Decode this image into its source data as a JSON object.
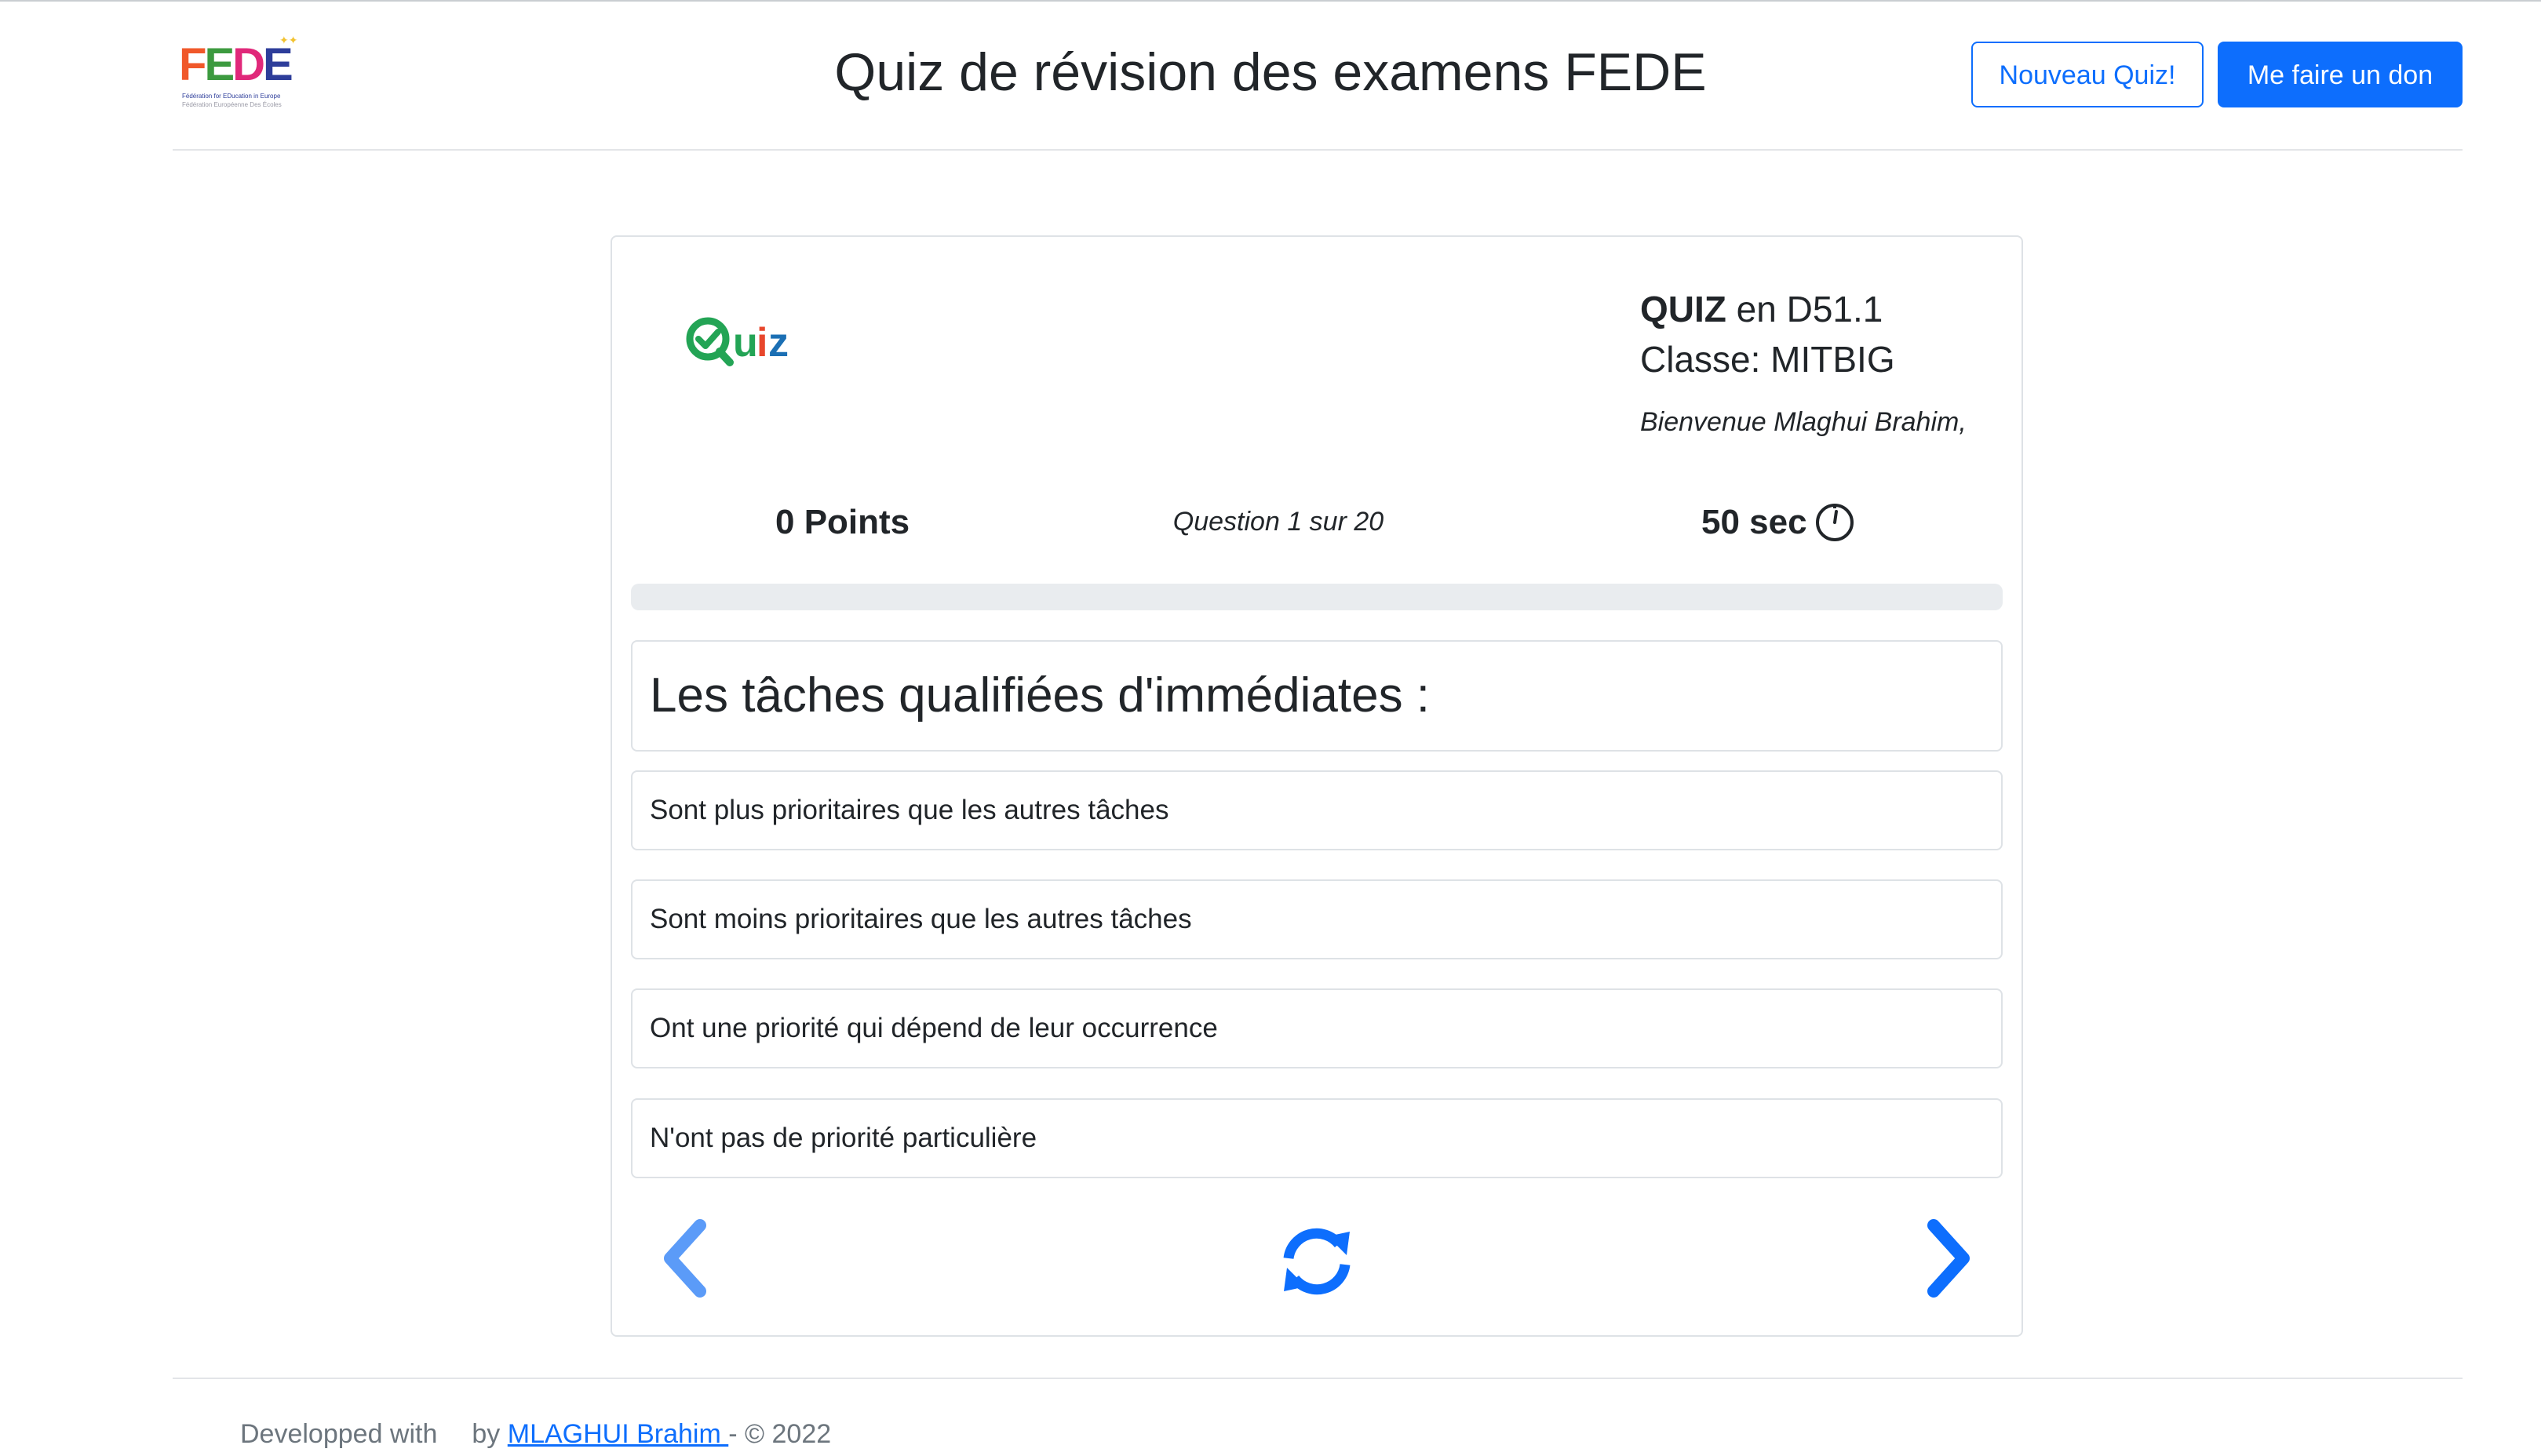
{
  "header": {
    "logo": {
      "text": "FEDE",
      "letter_colors": [
        "#f0582a",
        "#3c9a3f",
        "#e0287a",
        "#2d3d9a"
      ],
      "subtitle_line1": "Fédération for EDucation in Europe",
      "subtitle_line2": "Fédération Européenne Des Écoles"
    },
    "title": "Quiz de révision des examens FEDE",
    "new_quiz_label": "Nouveau Quiz!",
    "donate_label": "Me faire un don"
  },
  "quiz": {
    "logo_text": "Quiz",
    "label_bold": "QUIZ",
    "label_rest": " en D51.1",
    "class_line": "Classe: MITBIG",
    "welcome": "Bienvenue Mlaghui Brahim,",
    "points": "0 Points",
    "question_counter": "Question 1 sur 20",
    "timer": "50 sec",
    "progress_percent": 0,
    "question": "Les tâches qualifiées d'immédiates :",
    "answers": [
      "Sont plus prioritaires que les autres tâches",
      "Sont moins prioritaires que les autres tâches",
      "Ont une priorité qui dépend de leur occurrence",
      "N'ont pas de priorité particulière"
    ]
  },
  "footer": {
    "prefix": "Developped with",
    "by": "by ",
    "author": "MLAGHUI Brahim ",
    "suffix": " - © 2022"
  },
  "colors": {
    "primary": "#0d6efd",
    "prev_arrow": "#5b9bf8",
    "quiz_green": "#23a455",
    "quiz_blue": "#1b6fb4"
  },
  "icons": [
    "logo-image",
    "quiz-logo-image",
    "stopwatch-icon",
    "chevron-left-icon",
    "refresh-icon",
    "chevron-right-icon"
  ]
}
